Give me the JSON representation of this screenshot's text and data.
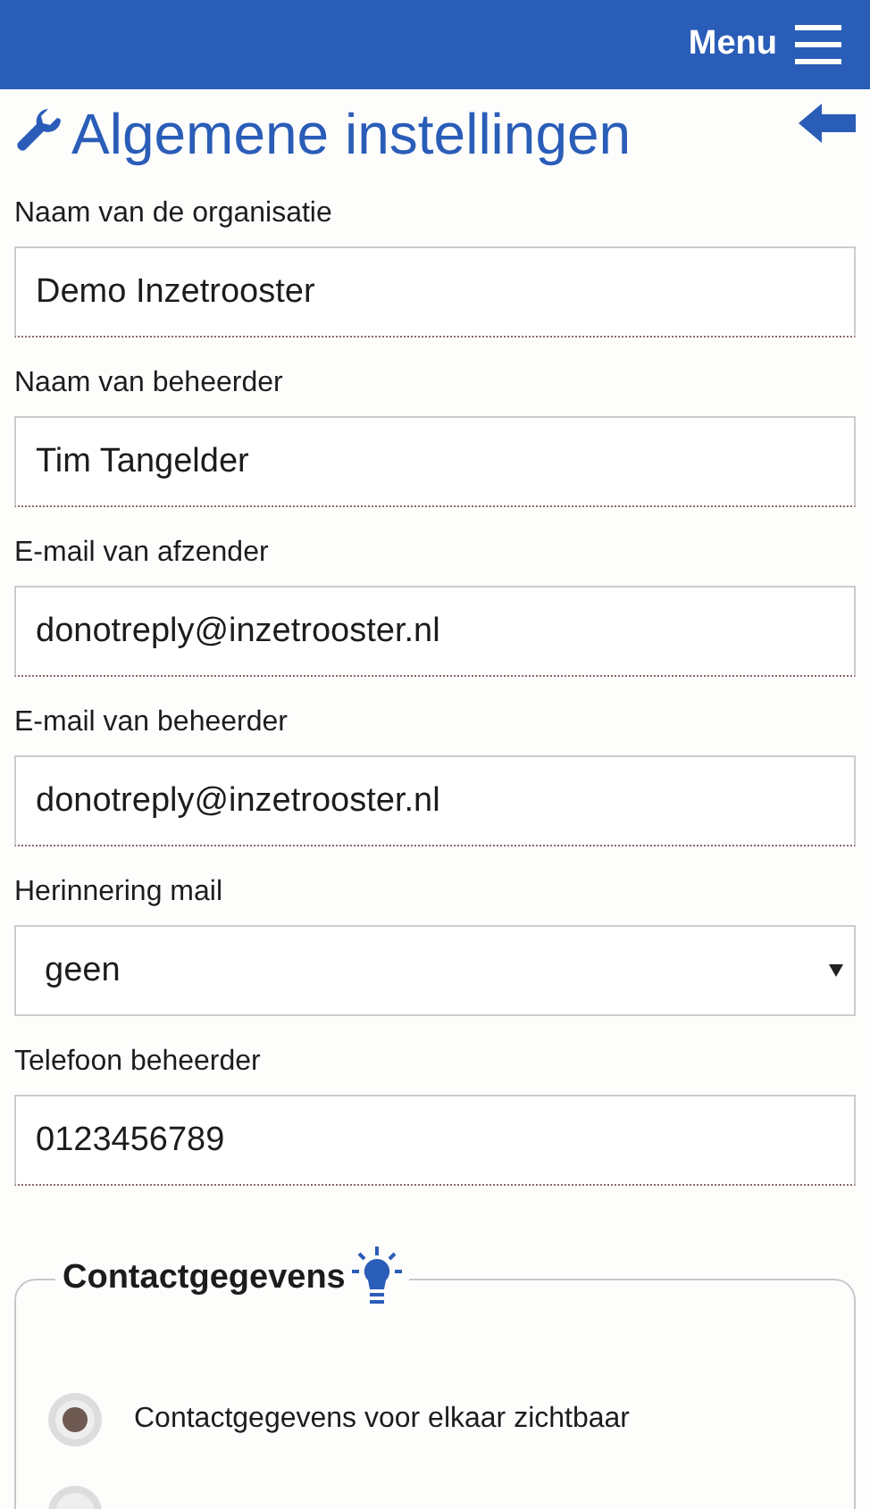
{
  "navbar": {
    "menu_label": "Menu"
  },
  "title": "Algemene instellingen",
  "fields": [
    {
      "kind": "text",
      "label": "Naam van de organisatie",
      "value": "Demo Inzetrooster"
    },
    {
      "kind": "text",
      "label": "Naam van beheerder",
      "value": "Tim Tangelder"
    },
    {
      "kind": "text",
      "label": "E-mail van afzender",
      "value": "donotreply@inzetrooster.nl"
    },
    {
      "kind": "text",
      "label": "E-mail van beheerder",
      "value": "donotreply@inzetrooster.nl"
    },
    {
      "kind": "select",
      "label": "Herinnering mail",
      "value": "geen"
    },
    {
      "kind": "text",
      "label": "Telefoon beheerder",
      "value": "0123456789"
    }
  ],
  "contact": {
    "legend": "Contactgegevens",
    "options": [
      {
        "label": "Contactgegevens voor elkaar zichtbaar",
        "selected": true
      },
      {
        "selected": false
      }
    ]
  }
}
